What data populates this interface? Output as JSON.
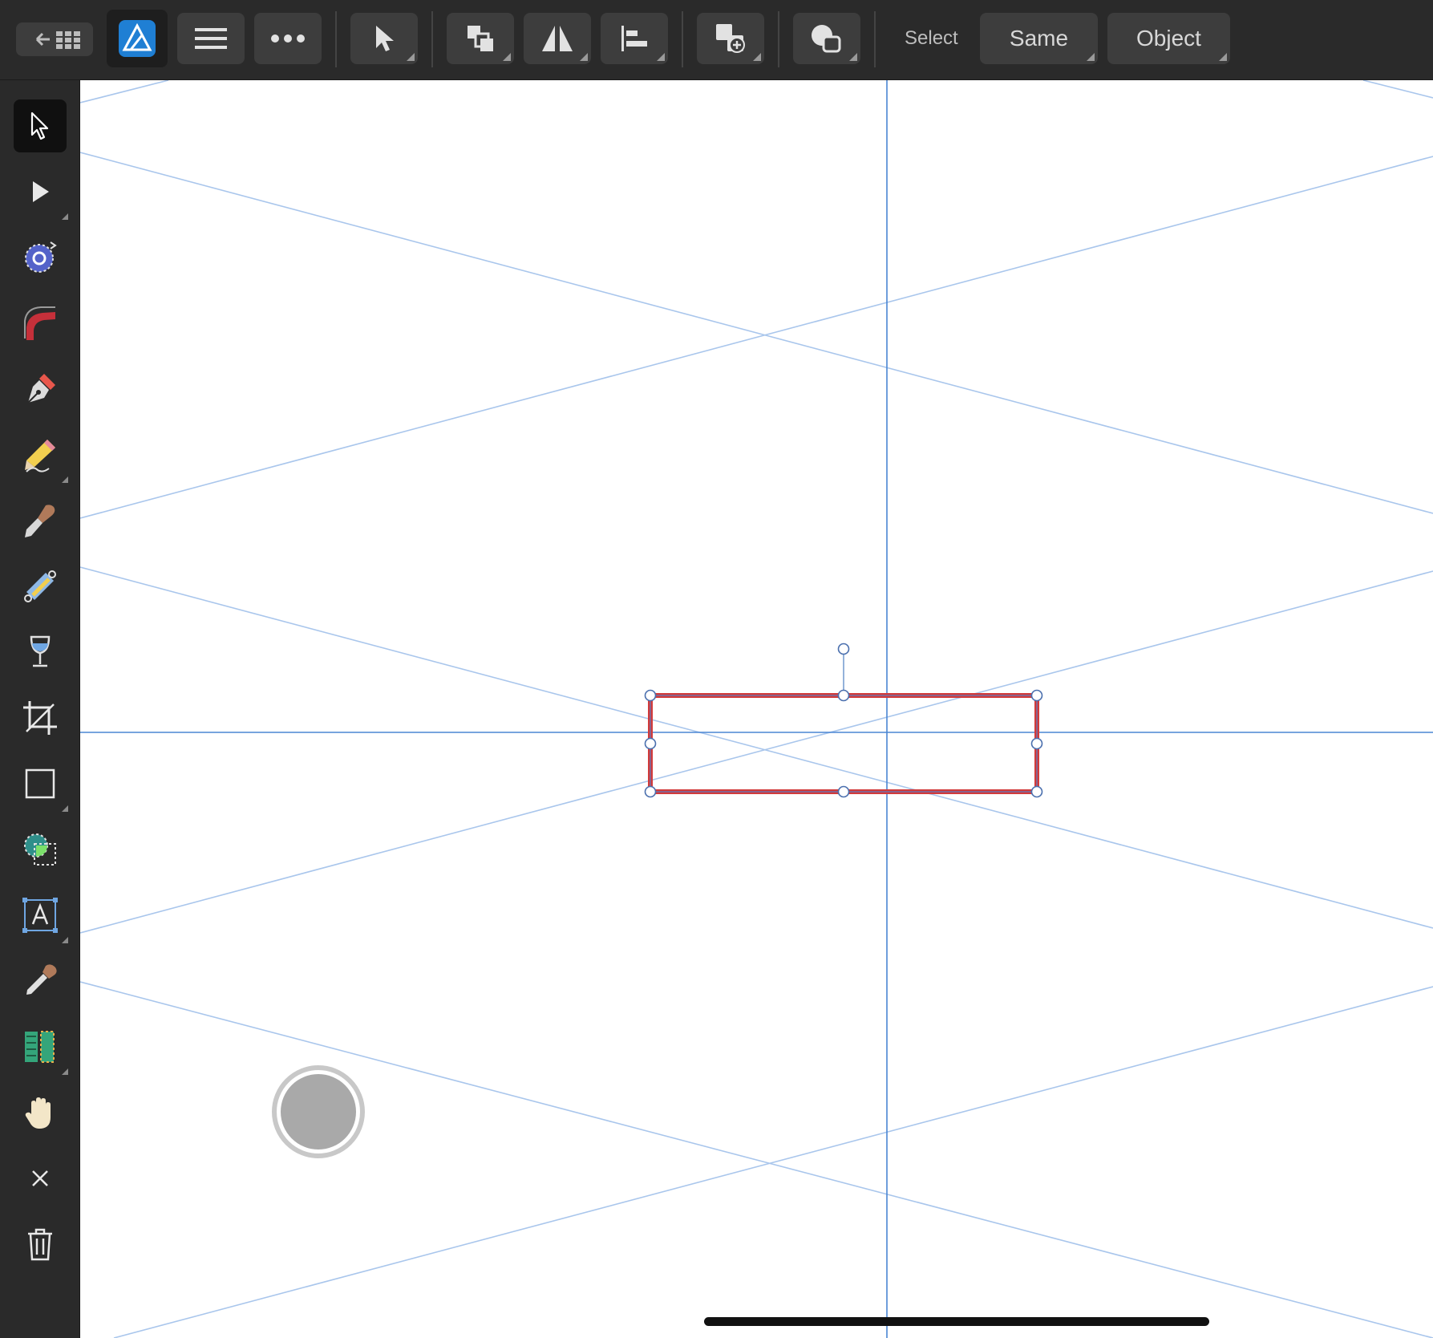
{
  "toolbar": {
    "select_label": "Select",
    "same_label": "Same",
    "object_label": "Object",
    "buttons": [
      "back-to-gallery",
      "app-persona",
      "document-menu",
      "more",
      "move-tool",
      "arrange",
      "flip",
      "align",
      "add-shape",
      "boolean-geometry"
    ]
  },
  "tools": [
    {
      "name": "move-tool",
      "active": true
    },
    {
      "name": "node-tool"
    },
    {
      "name": "point-transform-tool"
    },
    {
      "name": "corner-tool"
    },
    {
      "name": "pen-tool"
    },
    {
      "name": "pencil-tool"
    },
    {
      "name": "vector-brush-tool"
    },
    {
      "name": "gradient-tool"
    },
    {
      "name": "fill-tool"
    },
    {
      "name": "crop-tool"
    },
    {
      "name": "rectangle-tool"
    },
    {
      "name": "shape-builder-tool"
    },
    {
      "name": "artistic-text-tool"
    },
    {
      "name": "color-picker-tool"
    },
    {
      "name": "transparency-tool"
    },
    {
      "name": "view-tool"
    },
    {
      "name": "close"
    },
    {
      "name": "delete"
    }
  ],
  "canvas": {
    "selection_stroke": "#d23a3a",
    "guide_color": "#4a86d4",
    "grid_color": "#a9c6ec"
  },
  "colors": {
    "toolbar_bg": "#2a2a2a",
    "button_bg": "#3d3d3d",
    "accent": "#4a9ef5"
  }
}
